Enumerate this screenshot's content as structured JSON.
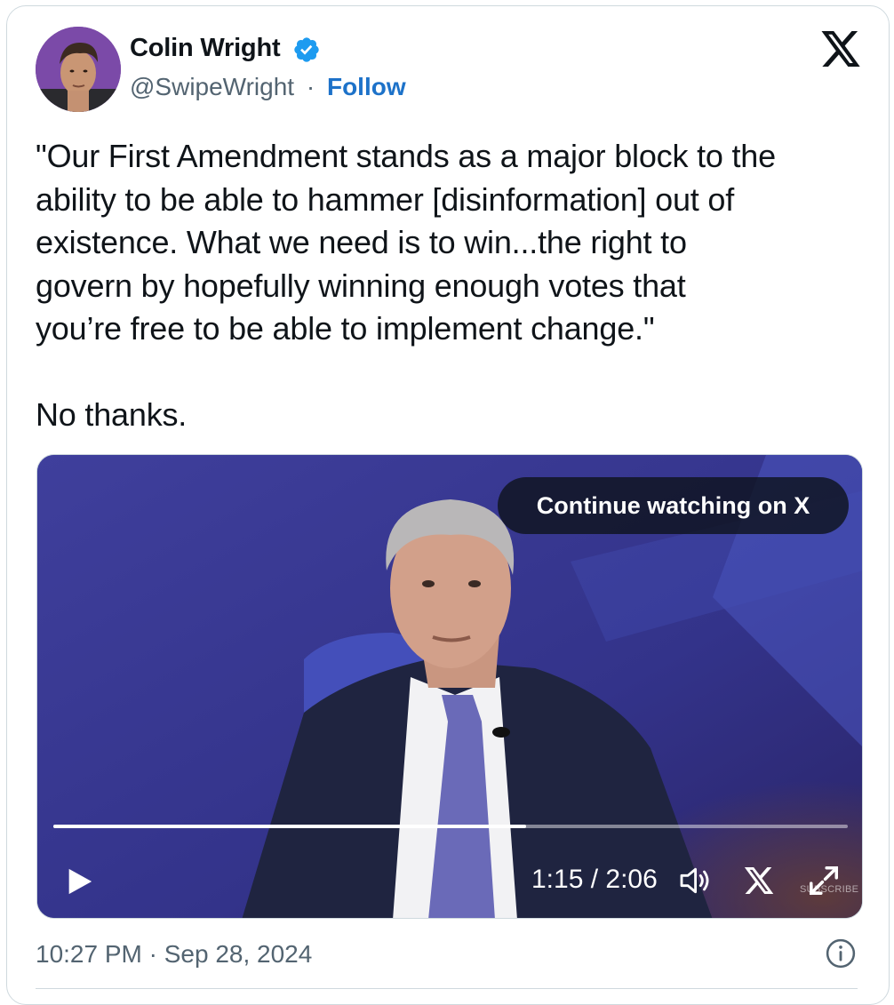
{
  "author": {
    "name": "Colin Wright",
    "handle": "@SwipeWright",
    "separator": "·",
    "follow_label": "Follow",
    "verified": true
  },
  "tweet": {
    "paragraph_1": "\"Our First Amendment stands as a major block to the\nability to be able to hammer [disinformation] out of\nexistence. What we need is to win...the right to\ngovern by hopefully winning enough votes that\nyou’re free to be able to implement change.\"",
    "paragraph_2": "No thanks."
  },
  "video": {
    "continue_label": "Continue watching on X",
    "current_time": "1:15",
    "duration": "2:06",
    "time_display": "1:15 / 2:06",
    "progress_fraction": 0.595,
    "watermark": "SUBSCRIBE"
  },
  "footer": {
    "time": "10:27 PM",
    "separator": "·",
    "date": "Sep 28, 2024",
    "timestamp_display": "10:27 PM · Sep 28, 2024"
  },
  "icons": {
    "verified": "verified-badge-icon",
    "x_logo": "x-logo-icon",
    "play": "play-icon",
    "volume": "volume-icon",
    "expand": "expand-icon",
    "info": "info-icon"
  },
  "colors": {
    "link": "#1d72c9",
    "verified": "#1d9bf0",
    "secondary_text": "#536471",
    "border": "#cfd9de"
  }
}
